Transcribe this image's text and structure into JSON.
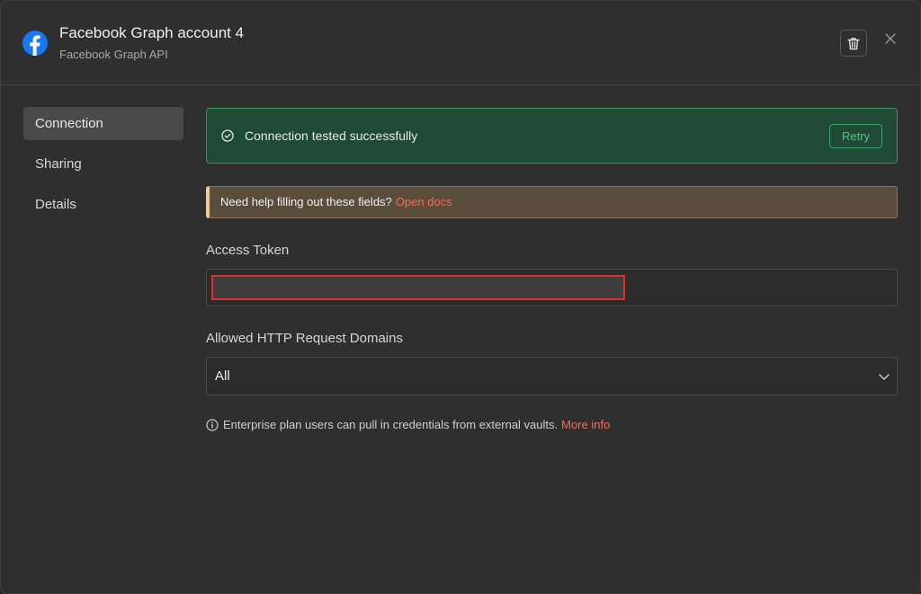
{
  "header": {
    "title": "Facebook Graph account 4",
    "subtitle": "Facebook Graph API",
    "icons": {
      "logo": "facebook-logo",
      "delete": "trash-icon",
      "close": "close-icon"
    }
  },
  "sidebar": {
    "items": [
      {
        "label": "Connection",
        "active": true
      },
      {
        "label": "Sharing",
        "active": false
      },
      {
        "label": "Details",
        "active": false
      }
    ]
  },
  "success_banner": {
    "text": "Connection tested successfully",
    "retry_label": "Retry",
    "icon": "check-circle-icon"
  },
  "help_banner": {
    "text": "Need help filling out these fields?",
    "link_text": "Open docs"
  },
  "access_token": {
    "label": "Access Token",
    "value": ""
  },
  "domains": {
    "label": "Allowed HTTP Request Domains",
    "selected": "All"
  },
  "info": {
    "text": "Enterprise plan users can pull in credentials from external vaults.",
    "link_text": "More info"
  },
  "colors": {
    "success_bg": "#1f4a35",
    "success_border": "#2f9a5e",
    "warning_bg": "#5b4d3c",
    "link": "#f26b5b",
    "facebook_blue": "#1877f2"
  }
}
